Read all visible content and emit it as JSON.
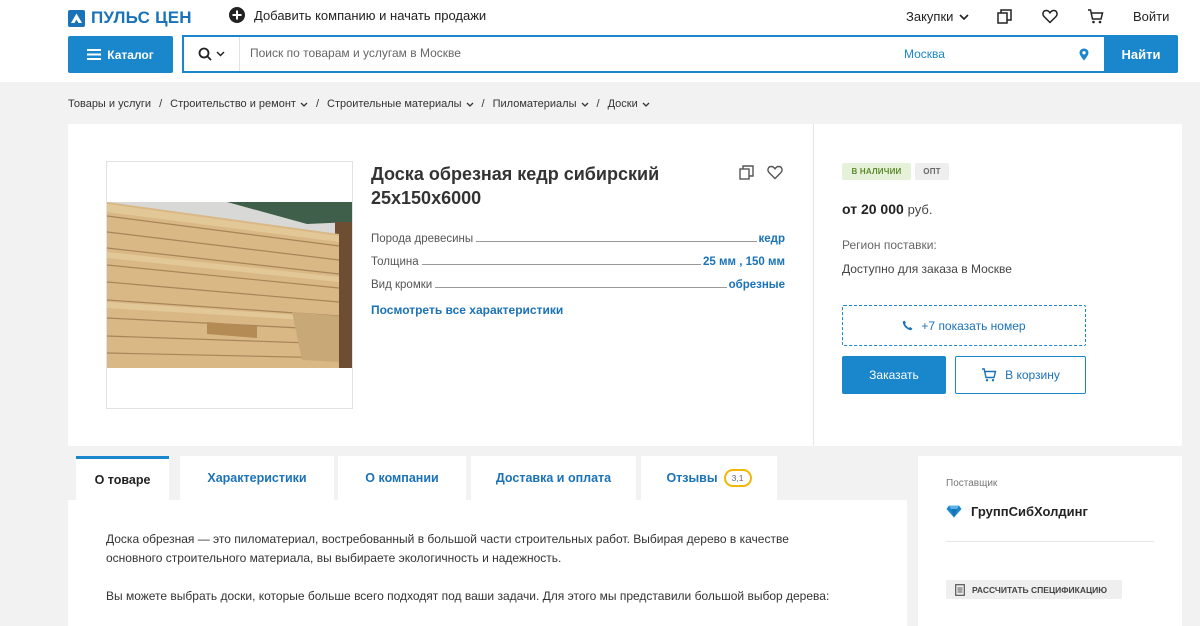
{
  "header": {
    "logo_text": "ПУЛЬС ЦЕН",
    "add_company_label": "Добавить компанию и начать продажи",
    "purchases_label": "Закупки",
    "login_label": "Войти",
    "catalog_button_label": "Каталог",
    "search_placeholder": "Поиск по товарам и услугам в Москве",
    "search_city": "Москва",
    "find_button_label": "Найти"
  },
  "breadcrumb": [
    {
      "label": "Товары и услуги"
    },
    {
      "label": "Строительство и ремонт"
    },
    {
      "label": "Строительные материалы"
    },
    {
      "label": "Пиломатериалы"
    },
    {
      "label": "Доски"
    }
  ],
  "product": {
    "title": "Доска обрезная кедр сибирский 25х150х6000",
    "specs": [
      {
        "name": "Порода древесины",
        "value": "кедр"
      },
      {
        "name": "Толщина",
        "value": "25 мм , 150 мм"
      },
      {
        "name": "Вид кромки",
        "value": "обрезные"
      }
    ],
    "all_specs_link": "Посмотреть все характеристики",
    "badges": {
      "in_stock": "в наличии",
      "wholesale": "опт"
    },
    "price_prefix": "от",
    "price_value": "20 000",
    "price_unit": "руб.",
    "region_label": "Регион поставки:",
    "region_value": "Доступно для заказа в Москве",
    "phone_button_label": "+7 показать номер",
    "order_button_label": "Заказать",
    "cart_button_label": "В корзину"
  },
  "tabs": [
    {
      "label": "О товаре"
    },
    {
      "label": "Характеристики"
    },
    {
      "label": "О компании"
    },
    {
      "label": "Доставка и оплата"
    },
    {
      "label": "Отзывы",
      "count": "3,1"
    }
  ],
  "description": {
    "paragraph1": "Доска обрезная — это пиломатериал, востребованный в большой части строительных работ. Выбирая дерево в качестве основного строительного материала, вы выбираете экологичность и надежность.",
    "paragraph2": "Вы можете выбрать доски, которые больше всего подходят под ваши задачи. Для этого мы представили большой выбор дерева:"
  },
  "supplier": {
    "label": "Поставщик",
    "name": "ГруппСибХолдинг",
    "spec_button_label": "Рассчитать спецификацию"
  },
  "colors": {
    "accent": "#1a86cc",
    "link": "#1a72b8",
    "stock_badge_bg": "#e5f2d9",
    "rating_ring": "#f2b705"
  }
}
